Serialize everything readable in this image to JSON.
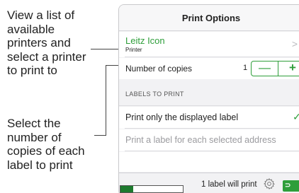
{
  "callouts": {
    "printers": "View a list of available printers and select a printer to print to",
    "copies": "Select the number of copies of each label to print"
  },
  "panel": {
    "title": "Print Options",
    "printer": {
      "name": "Leitz Icon",
      "sublabel": "Printer"
    },
    "copies": {
      "label": "Number of copies",
      "value": "1",
      "minus": "—",
      "plus": "+"
    },
    "section_header": "LABELS TO PRINT",
    "options": [
      {
        "label": "Print only the displayed label",
        "selected": true
      },
      {
        "label": "Print a label for each selected address",
        "selected": false
      }
    ],
    "footer": {
      "progress_fraction": 0.2,
      "status": "1 label will print",
      "print_button_glyph": "⊃"
    }
  },
  "colors": {
    "accent": "#2e9e3a",
    "progress": "#1e7a2e",
    "muted_text": "#9b9b9f"
  },
  "icons": {
    "chevron": "chevron-right-icon",
    "check": "checkmark-icon",
    "gear": "gear-icon"
  }
}
